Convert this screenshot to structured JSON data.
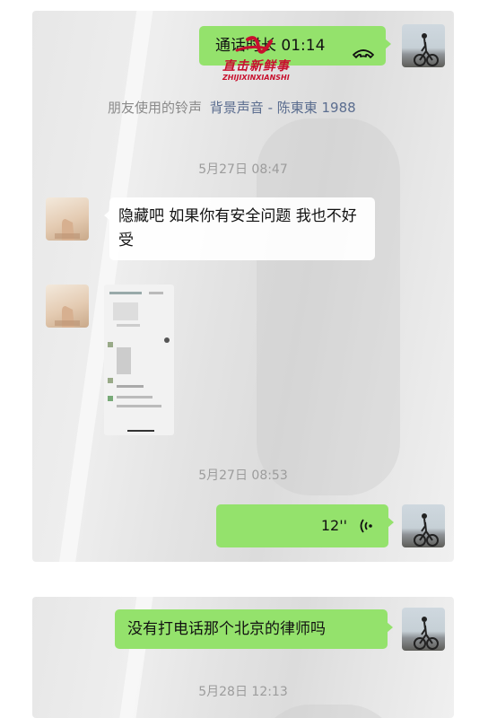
{
  "chat1": {
    "call_label": "通话时长 01:14",
    "ringtone_label": "朋友使用的铃声",
    "ringtone_value": "背景声音 - 陈東東 1988",
    "time1": "5月27日 08:47",
    "friend_message": "隐藏吧 如果你有安全问题 我也不好受",
    "time2": "5月27日 08:53",
    "voice_duration": "12''"
  },
  "chat2": {
    "message": "没有打电话那个北京的律师吗",
    "time": "5月28日 12:13"
  },
  "watermark": {
    "brand": "直击新鲜事",
    "pinyin": "ZHIJIXINXIANSHI",
    "brand_color": "#c8102e"
  },
  "colors": {
    "bubble_green": "#94e26c",
    "timestamp_gray": "#9c9c9c"
  }
}
